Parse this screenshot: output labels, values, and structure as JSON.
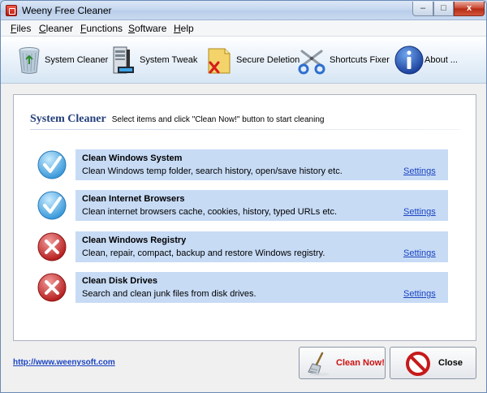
{
  "window": {
    "title": "Weeny Free Cleaner",
    "controls": {
      "minimize": "–",
      "maximize": "□",
      "close": "x"
    }
  },
  "menu": [
    "Files",
    "Cleaner",
    "Functions",
    "Software",
    "Help"
  ],
  "toolbar": [
    {
      "label": "System Cleaner",
      "icon": "recycle-bin-icon"
    },
    {
      "label": "System Tweak",
      "icon": "computer-tower-icon"
    },
    {
      "label": "Secure Deletion",
      "icon": "shred-file-icon"
    },
    {
      "label": "Shortcuts Fixer",
      "icon": "scissors-icon"
    },
    {
      "label": "About ...",
      "icon": "info-icon"
    }
  ],
  "panel": {
    "title": "System Cleaner",
    "subtitle": "Select items and click \"Clean Now!\" button to start cleaning"
  },
  "items": [
    {
      "title": "Clean Windows System",
      "description": "Clean Windows temp folder, search history, open/save history etc.",
      "link": "Settings",
      "checked": true
    },
    {
      "title": "Clean Internet Browsers",
      "description": "Clean internet browsers cache, cookies, history, typed URLs etc.",
      "link": "Settings",
      "checked": true
    },
    {
      "title": "Clean Windows Registry",
      "description": "Clean, repair, compact, backup and restore Windows registry.",
      "link": "Settings",
      "checked": false
    },
    {
      "title": "Clean Disk Drives",
      "description": "Search and clean junk files from disk drives.",
      "link": "Settings",
      "checked": false
    }
  ],
  "footer": {
    "website": "http://www.weenysoft.com",
    "clean_button": "Clean Now!",
    "close_button": "Close"
  },
  "colors": {
    "row_background": "#c7dbf5",
    "checked": "#4aa3e0",
    "unchecked": "#c62a2a",
    "title": "#233f7a",
    "link": "#1b44c2"
  }
}
